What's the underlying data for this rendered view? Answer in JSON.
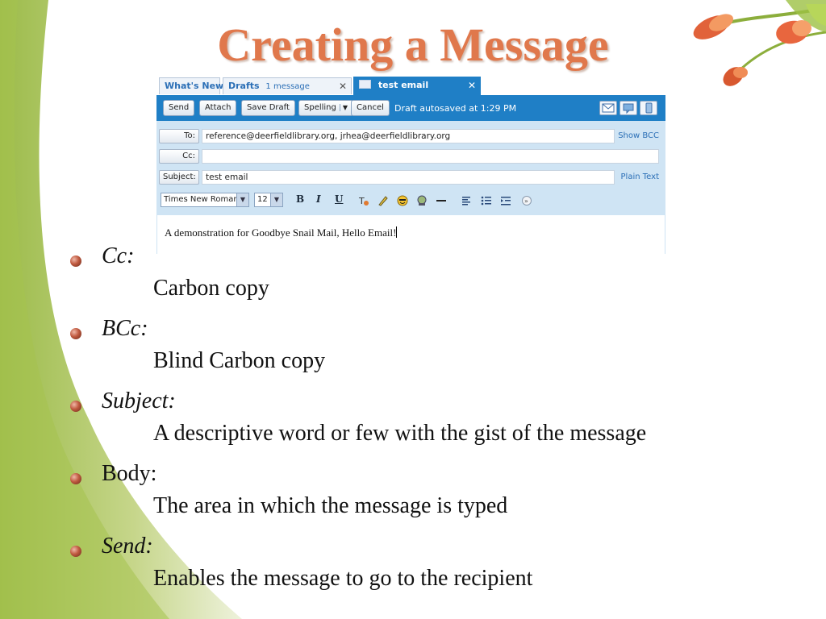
{
  "slide": {
    "title": "Creating a Message"
  },
  "colors": {
    "title": "#e0784c",
    "swoosh_light": "#dfe8c4",
    "swoosh_dark": "#9cbb4a",
    "toolbar_blue": "#1f7fc6",
    "fields_bg": "#cfe4f4",
    "link_blue": "#2b6fb6"
  },
  "email": {
    "tabs": [
      {
        "label": "What's New",
        "sub": ""
      },
      {
        "label": "Drafts",
        "sub": "1 message",
        "close": "✕"
      },
      {
        "label": "test email",
        "close": "✕",
        "icon": "mail-icon"
      }
    ],
    "toolbar": {
      "send": "Send",
      "attach": "Attach",
      "save_draft": "Save Draft",
      "spelling": "Spelling",
      "cancel": "Cancel",
      "autosave": "Draft autosaved at 1:29 PM",
      "right_icons": [
        "email-view-icon",
        "im-icon",
        "mobile-icon"
      ]
    },
    "fields": {
      "to_label": "To:",
      "to_value": "reference@deerfieldlibrary.org, jrhea@deerfieldlibrary.org",
      "show_bcc": "Show BCC",
      "cc_label": "Cc:",
      "cc_value": "",
      "subject_label": "Subject:",
      "subject_value": "test email",
      "plain_text": "Plain Text"
    },
    "format": {
      "font": "Times New Roman",
      "size": "12",
      "bold": "B",
      "italic": "I",
      "underline": "U",
      "icons": [
        "text-color-icon",
        "highlight-icon",
        "emoticon-icon",
        "insert-image-icon",
        "horizontal-rule-icon",
        "align-icon",
        "list-icon",
        "indent-icon",
        "more-icon"
      ]
    },
    "body_text": "A demonstration for Goodbye Snail Mail, Hello Email!"
  },
  "bullets": [
    {
      "term": "Cc:",
      "italic": true,
      "definition": "Carbon copy"
    },
    {
      "term": "BCc:",
      "italic": true,
      "definition": "Blind Carbon copy"
    },
    {
      "term": "Subject:",
      "italic": true,
      "definition": "A descriptive word or few with the gist of the message"
    },
    {
      "term": "Body:",
      "italic": false,
      "definition": "The area in which the message is typed"
    },
    {
      "term": "Send:",
      "italic": true,
      "definition": "Enables the message to go to the recipient"
    }
  ]
}
